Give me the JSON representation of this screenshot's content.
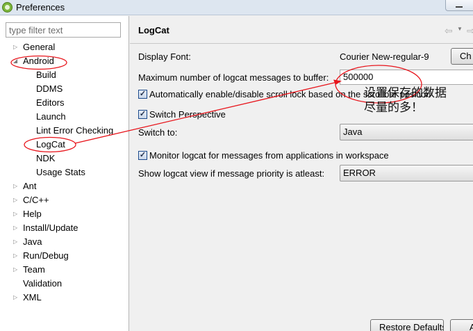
{
  "window": {
    "title": "Preferences"
  },
  "filter": {
    "placeholder": "type filter text"
  },
  "tree": [
    {
      "label": "General",
      "arrow": "▷"
    },
    {
      "label": "Android",
      "arrow": "◢"
    },
    {
      "label": "Build",
      "arrow": ""
    },
    {
      "label": "DDMS",
      "arrow": ""
    },
    {
      "label": "Editors",
      "arrow": ""
    },
    {
      "label": "Launch",
      "arrow": ""
    },
    {
      "label": "Lint Error Checking",
      "arrow": ""
    },
    {
      "label": "LogCat",
      "arrow": ""
    },
    {
      "label": "NDK",
      "arrow": ""
    },
    {
      "label": "Usage Stats",
      "arrow": ""
    },
    {
      "label": "Ant",
      "arrow": "▷"
    },
    {
      "label": "C/C++",
      "arrow": "▷"
    },
    {
      "label": "Help",
      "arrow": "▷"
    },
    {
      "label": "Install/Update",
      "arrow": "▷"
    },
    {
      "label": "Java",
      "arrow": "▷"
    },
    {
      "label": "Run/Debug",
      "arrow": "▷"
    },
    {
      "label": "Team",
      "arrow": "▷"
    },
    {
      "label": "Validation",
      "arrow": ""
    },
    {
      "label": "XML",
      "arrow": "▷"
    }
  ],
  "page": {
    "title": "LogCat",
    "display_font_label": "Display Font:",
    "display_font_value": "Courier New-regular-9",
    "change_button": "Ch",
    "max_messages_label": "Maximum number of logcat messages to buffer:",
    "max_messages_value": "500000",
    "auto_scroll_label": "Automatically enable/disable scroll lock based on the scrollbar position",
    "auto_scroll_checked": true,
    "switch_perspective_label": "Switch Perspective",
    "switch_perspective_checked": true,
    "switch_to_label": "Switch to:",
    "switch_to_value": "Java",
    "monitor_label": "Monitor logcat for messages from applications in workspace",
    "monitor_checked": true,
    "show_view_label": "Show logcat view if message priority is atleast:",
    "show_view_value": "ERROR",
    "restore_defaults": "Restore Defaults",
    "apply": "A"
  },
  "icons": {
    "back": "back-arrow-icon",
    "forward": "forward-arrow-icon",
    "check": "✓"
  },
  "annotation": {
    "note_line1": "设置保存的数据",
    "note_line2": "尽量的多！",
    "color": "#e8141b"
  }
}
